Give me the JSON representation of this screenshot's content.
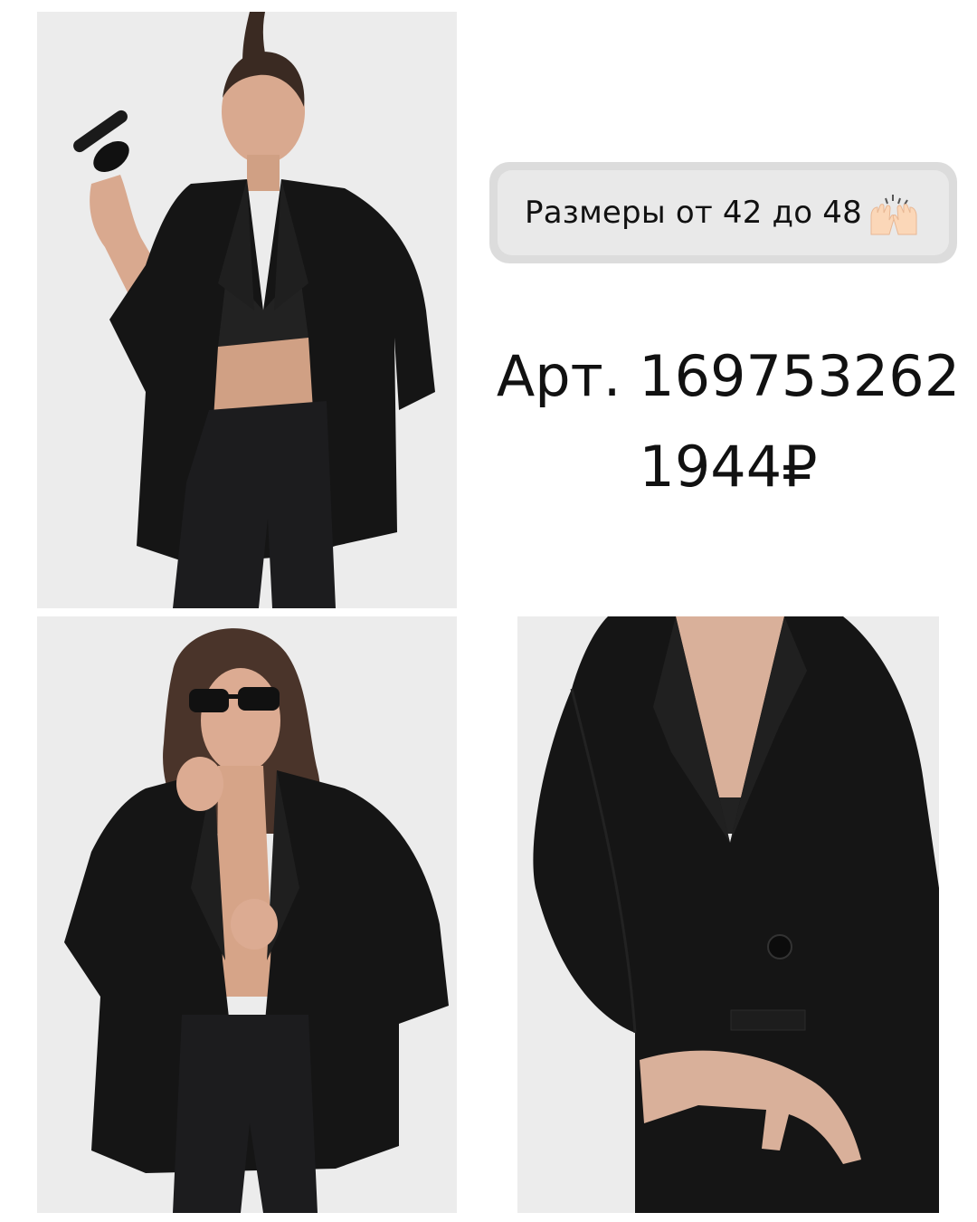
{
  "badge": {
    "sizes_text": "Размеры от 42 до 48",
    "icon": "raising-hands-icon"
  },
  "product": {
    "article_text": "Арт. 169753262",
    "price_text": "1944₽"
  },
  "photos": [
    {
      "name": "photo-model-full-sunglasses-in-hand"
    },
    {
      "name": "photo-model-sunglasses-on"
    },
    {
      "name": "photo-jacket-closeup"
    }
  ],
  "colors": {
    "background": "#ffffff",
    "badge_outer": "#dcdcdc",
    "badge_inner": "#e9e9e9",
    "text": "#111111",
    "jacket": "#151515",
    "photo_bg": "#ebebeb"
  }
}
